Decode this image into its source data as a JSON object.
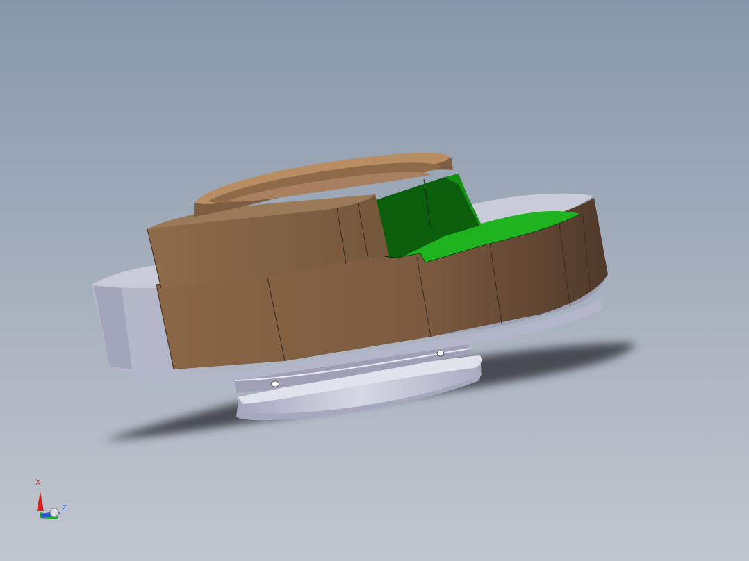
{
  "viewport": {
    "background_top": "#8797ab",
    "background_bottom": "#c1c6ce"
  },
  "model": {
    "colors": {
      "bronze_top": "#b88d64",
      "bronze_side": "#8a6645",
      "bronze_dark": "#5b4130",
      "silver": "#c8cad8",
      "silver_dark": "#8f91a6",
      "green_light": "#1fb31f",
      "green_dark": "#0b5e0b",
      "shadow": "#3c3f47"
    }
  },
  "triad": {
    "x_label": "X",
    "z_label": "Z",
    "x_color": "#d42020",
    "y_color": "#1faa2e",
    "z_color": "#2a55d4"
  }
}
